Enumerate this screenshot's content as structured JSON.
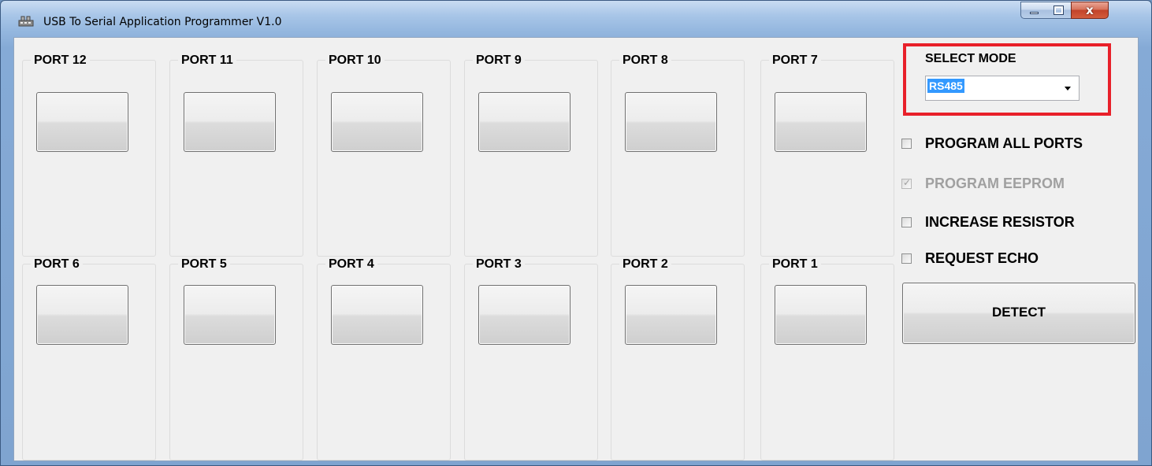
{
  "window": {
    "title": "USB To Serial Application Programmer V1.0",
    "close_symbol": "x",
    "app_icon": "usb-device-icon"
  },
  "ports": {
    "top_row": [
      "PORT 12",
      "PORT 11",
      "PORT 10",
      "PORT 9",
      "PORT 8",
      "PORT 7"
    ],
    "bottom_row": [
      "PORT 6",
      "PORT 5",
      "PORT 4",
      "PORT 3",
      "PORT 2",
      "PORT 1"
    ]
  },
  "mode": {
    "label": "SELECT MODE",
    "selected": "RS485"
  },
  "options": {
    "program_all_ports": {
      "label": "PROGRAM ALL PORTS",
      "checked": false,
      "enabled": true
    },
    "program_eeprom": {
      "label": "PROGRAM EEPROM",
      "checked": true,
      "enabled": false
    },
    "increase_resistor": {
      "label": "INCREASE RESISTOR",
      "checked": false,
      "enabled": true
    },
    "request_echo": {
      "label": "REQUEST ECHO",
      "checked": false,
      "enabled": true
    }
  },
  "detect_label": "DETECT",
  "colors": {
    "highlight_border": "#e8202a",
    "selection": "#3399ff",
    "close_button": "#c2432a"
  }
}
